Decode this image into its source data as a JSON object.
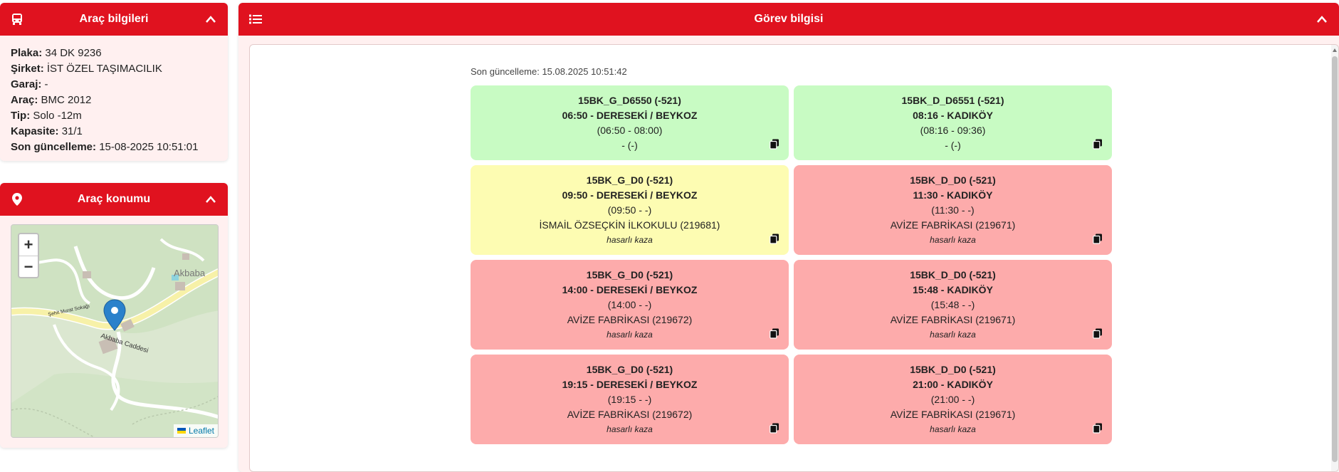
{
  "vehicle_panel": {
    "title": "Araç bilgileri",
    "icon": "bus-icon",
    "rows": [
      {
        "label": "Plaka:",
        "value": "34 DK 9236"
      },
      {
        "label": "Şirket:",
        "value": "İST ÖZEL TAŞIMACILIK"
      },
      {
        "label": "Garaj:",
        "value": "-"
      },
      {
        "label": "Araç:",
        "value": "BMC 2012"
      },
      {
        "label": "Tip:",
        "value": "Solo -12m"
      },
      {
        "label": "Kapasite:",
        "value": "31/1"
      },
      {
        "label": "Son güncelleme:",
        "value": "15-08-2025 10:51:01"
      }
    ]
  },
  "location_panel": {
    "title": "Araç konumu",
    "icon": "map-pin-icon",
    "zoom_in": "+",
    "zoom_out": "−",
    "attribution": "Leaflet",
    "map_labels": {
      "place": "Akbaba",
      "street_main": "Akbaba Caddesi",
      "street_side": "Şehit Murat Sokağı"
    }
  },
  "task_panel": {
    "title": "Görev bilgisi",
    "icon": "list-icon",
    "updated": "Son güncelleme: 15.08.2025 10:51:42",
    "cards": [
      {
        "status": "green",
        "l1": "15BK_G_D6550 (-521)",
        "l2": "06:50 - DERESEKİ / BEYKOZ",
        "l3": "(06:50 - 08:00)",
        "l4": "- (-)",
        "note": ""
      },
      {
        "status": "green",
        "l1": "15BK_D_D6551 (-521)",
        "l2": "08:16 - KADIKÖY",
        "l3": "(08:16 - 09:36)",
        "l4": "- (-)",
        "note": ""
      },
      {
        "status": "yellow",
        "l1": "15BK_G_D0 (-521)",
        "l2": "09:50 - DERESEKİ / BEYKOZ",
        "l3": "(09:50 - -)",
        "l4": "İSMAİL ÖZSEÇKİN İLKOKULU (219681)",
        "note": "hasarlı kaza"
      },
      {
        "status": "red",
        "l1": "15BK_D_D0 (-521)",
        "l2": "11:30 - KADIKÖY",
        "l3": "(11:30 - -)",
        "l4": "AVİZE FABRİKASI (219671)",
        "note": "hasarlı kaza"
      },
      {
        "status": "red",
        "l1": "15BK_G_D0 (-521)",
        "l2": "14:00 - DERESEKİ / BEYKOZ",
        "l3": "(14:00 - -)",
        "l4": "AVİZE FABRİKASI (219672)",
        "note": "hasarlı kaza"
      },
      {
        "status": "red",
        "l1": "15BK_D_D0 (-521)",
        "l2": "15:48 - KADIKÖY",
        "l3": "(15:48 - -)",
        "l4": "AVİZE FABRİKASI (219671)",
        "note": "hasarlı kaza"
      },
      {
        "status": "red",
        "l1": "15BK_G_D0 (-521)",
        "l2": "19:15 - DERESEKİ / BEYKOZ",
        "l3": "(19:15 - -)",
        "l4": "AVİZE FABRİKASI (219672)",
        "note": "hasarlı kaza"
      },
      {
        "status": "red",
        "l1": "15BK_D_D0 (-521)",
        "l2": "21:00 - KADIKÖY",
        "l3": "(21:00 - -)",
        "l4": "AVİZE FABRİKASI (219671)",
        "note": "hasarlı kaza"
      }
    ]
  },
  "colors": {
    "header_red": "#e0121f",
    "panel_bg": "#fff0f0",
    "card_green": "#c8fbc3",
    "card_yellow": "#fdfcb2",
    "card_red": "#fdabab"
  }
}
